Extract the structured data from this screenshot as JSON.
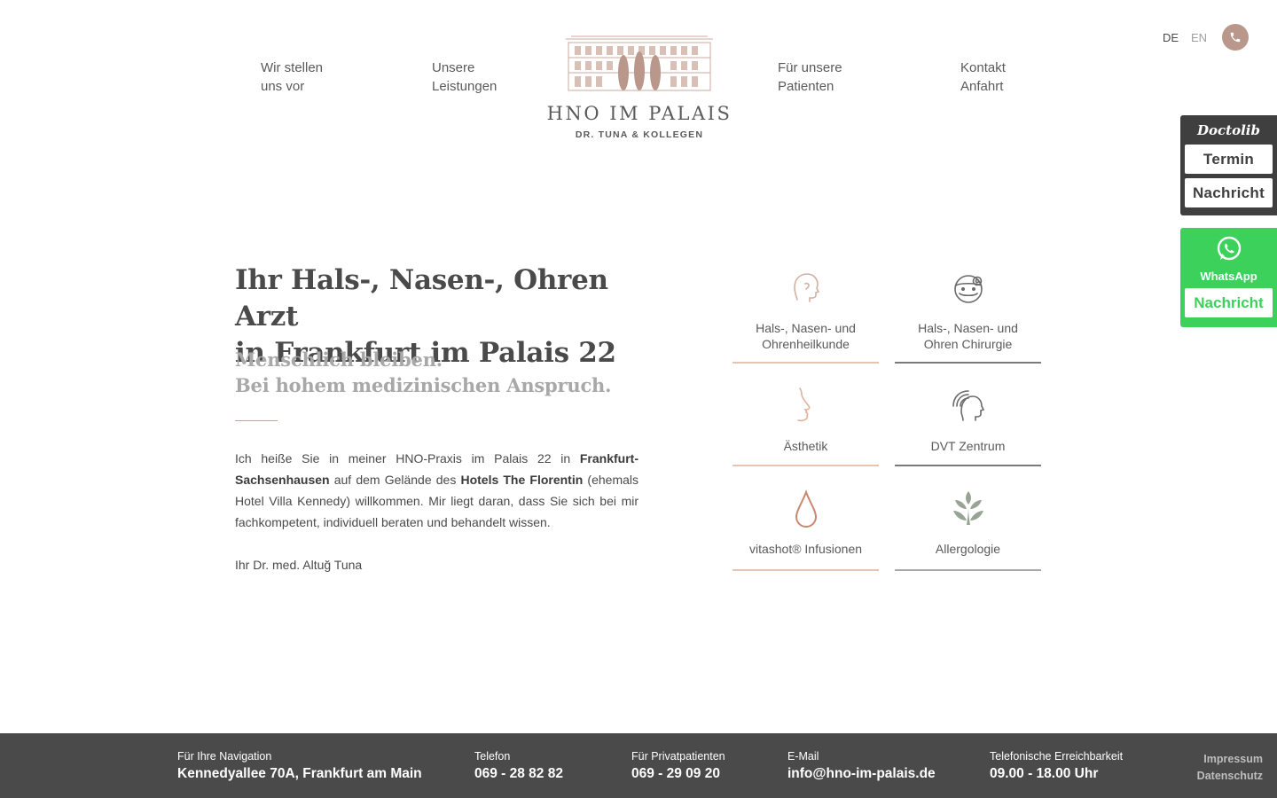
{
  "header": {
    "nav": [
      {
        "line1": "Wir stellen",
        "line2": "uns vor"
      },
      {
        "line1": "Unsere",
        "line2": "Leistungen"
      },
      {
        "line1": "Für unsere",
        "line2": "Patienten"
      },
      {
        "line1": "Kontakt",
        "line2": "Anfahrt"
      }
    ],
    "logo_title": "HNO IM PALAIS",
    "logo_subtitle": "DR. TUNA & KOLLEGEN",
    "lang_de": "DE",
    "lang_en": "EN"
  },
  "widgets": {
    "doctolib_logo": "Doctolib",
    "doctolib_termin": "Termin",
    "doctolib_nachricht": "Nachricht",
    "whatsapp_label": "WhatsApp",
    "whatsapp_nachricht": "Nachricht"
  },
  "main": {
    "headline_line1": "Ihr Hals-, Nasen-, Ohren Arzt",
    "headline_line2": "in Frankfurt im Palais 22",
    "subline_line1": "Menschlich bleiben.",
    "subline_line2": "Bei hohem medizinischen Anspruch.",
    "intro_1": "Ich heiße Sie in meiner HNO-Praxis im Palais 22 in ",
    "intro_bold1": "Frankfurt-Sachsenhausen",
    "intro_2": " auf dem Gelände des ",
    "intro_bold2": "Hotels The Florentin",
    "intro_3": " (ehemals Hotel Villa Kennedy) willkommen. Mir liegt daran, dass Sie sich bei mir fachkompetent, individuell beraten und behandelt wissen.",
    "signature": "Ihr Dr. med. Altuğ Tuna"
  },
  "services": [
    {
      "line1": "Hals-, Nasen- und",
      "line2": "Ohrenheilkunde",
      "icon": "head-profile-icon"
    },
    {
      "line1": "Hals-, Nasen- und",
      "line2": "Ohren Chirurgie",
      "icon": "surgeon-icon"
    },
    {
      "line1": "Ästhetik",
      "line2": "",
      "icon": "nose-profile-icon"
    },
    {
      "line1": "DVT Zentrum",
      "line2": "",
      "icon": "head-scan-icon"
    },
    {
      "line1": "vitashot® Infusionen",
      "line2": "",
      "icon": "drop-icon"
    },
    {
      "line1": "Allergologie",
      "line2": "",
      "icon": "plant-icon"
    }
  ],
  "footer": {
    "nav_label": "Für Ihre Navigation",
    "nav_value": "Kennedyallee 70A, Frankfurt am Main",
    "phone_label": "Telefon",
    "phone_value": "069 - 28 82 82",
    "private_label": "Für Privatpatienten",
    "private_value": "069 - 29 09 20",
    "email_label": "E-Mail",
    "email_value": "info@hno-im-palais.de",
    "hours_label": "Telefonische Erreichbarkeit",
    "hours_value": "09.00 - 18.00 Uhr",
    "impressum": "Impressum",
    "datenschutz": "Datenschutz"
  },
  "colors": {
    "accent_rose": "#b9978a",
    "doctolib_bg": "#3f3f3f",
    "whatsapp_green": "#3cd15b",
    "footer_bg": "#4a4a4a"
  }
}
